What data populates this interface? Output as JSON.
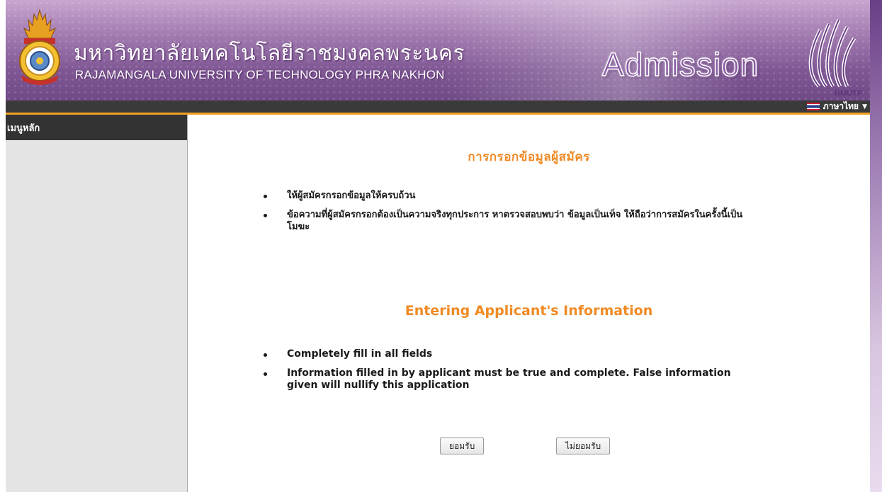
{
  "header": {
    "university_th": "มหาวิทยาลัยเทคโนโลยีราชมงคลพระนคร",
    "university_en": "RAJAMANGALA UNIVERSITY OF TECHNOLOGY PHRA NAKHON",
    "admission_title": "Admission",
    "logo_text": "RMUTP",
    "colors": {
      "banner": "#7f5794",
      "accent": "#f08a24",
      "navbar": "#3a3a3a"
    }
  },
  "navbar": {
    "language_label": "ภาษาไทย",
    "language_flag_icon": "thai-flag-icon",
    "dropdown_icon": "caret-down-icon"
  },
  "sidebar": {
    "title": "เมนูหลัก"
  },
  "main": {
    "heading_th": "การกรอกข้อมูลผู้สมัคร",
    "bullets_th": [
      "ให้ผู้สมัครกรอกข้อมูลให้ครบถ้วน",
      "ข้อความที่ผู้สมัครกรอกต้องเป็นความจริงทุกประการ หาตรวจสอบพบว่า ข้อมูลเป็นเท็จ ให้ถือว่าการสมัครในครั้งนี้เป็นโมฆะ"
    ],
    "heading_en": "Entering Applicant's Information",
    "bullets_en": [
      "Completely fill in all fields",
      "Information filled in by applicant must be true and complete. False information given will nullify this application"
    ],
    "accept_label": "ยอมรับ",
    "decline_label": "ไม่ยอมรับ"
  }
}
